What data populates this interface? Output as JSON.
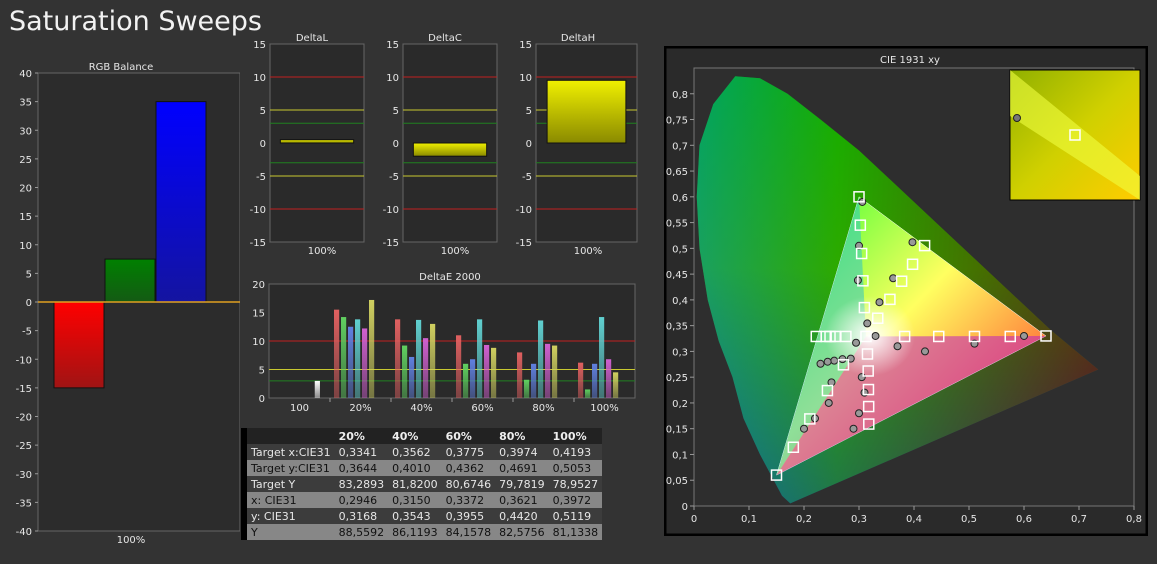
{
  "page": {
    "title": "Saturation Sweeps"
  },
  "rgb_balance": {
    "title": "RGB Balance",
    "xlabel": "100%",
    "ylim": [
      -40,
      40
    ],
    "yticks": [
      "40",
      "35",
      "30",
      "25",
      "20",
      "15",
      "10",
      "5",
      "0",
      "-5",
      "-10",
      "-15",
      "-20",
      "-25",
      "-30",
      "-35",
      "-40"
    ]
  },
  "delta_panels": {
    "yticks": [
      "15",
      "10",
      "5",
      "0",
      "-5",
      "-10",
      "-15"
    ],
    "xlabel": "100%"
  },
  "deltae": {
    "title": "DeltaE 2000",
    "yticks": [
      "20",
      "15",
      "10",
      "5",
      "0"
    ],
    "xticks": [
      "100",
      "20%",
      "40%",
      "60%",
      "80%",
      "100%"
    ]
  },
  "cie": {
    "title": "CIE 1931 xy",
    "xticks": [
      "0",
      "0,1",
      "0,2",
      "0,3",
      "0,4",
      "0,5",
      "0,6",
      "0,7",
      "0,8"
    ],
    "yticks": [
      "0,8",
      "0,75",
      "0,7",
      "0,65",
      "0,6",
      "0,55",
      "0,5",
      "0,45",
      "0,4",
      "0,35",
      "0,3",
      "0,25",
      "0,2",
      "0,15",
      "0,1",
      "0,05",
      "0"
    ]
  },
  "table": {
    "header": [
      "",
      "20%",
      "40%",
      "60%",
      "80%",
      "100%"
    ],
    "rows": [
      {
        "label": "Target x:CIE31",
        "values": [
          "0,3341",
          "0,3562",
          "0,3775",
          "0,3974",
          "0,4193"
        ]
      },
      {
        "label": "Target y:CIE31",
        "values": [
          "0,3644",
          "0,4010",
          "0,4362",
          "0,4691",
          "0,5053"
        ]
      },
      {
        "label": "Target Y",
        "values": [
          "83,2893",
          "81,8200",
          "80,6746",
          "79,7819",
          "78,9527"
        ]
      },
      {
        "label": "x: CIE31",
        "values": [
          "0,2946",
          "0,3150",
          "0,3372",
          "0,3621",
          "0,3972"
        ]
      },
      {
        "label": "y: CIE31",
        "values": [
          "0,3168",
          "0,3543",
          "0,3955",
          "0,4420",
          "0,5119"
        ]
      },
      {
        "label": "Y",
        "values": [
          "88,5592",
          "86,1193",
          "84,1578",
          "82,5756",
          "81,1338"
        ]
      }
    ]
  },
  "chart_data": [
    {
      "type": "bar",
      "title": "RGB Balance",
      "categories": [
        "100%"
      ],
      "series": [
        {
          "color": "#ff0000",
          "values": [
            -15
          ]
        },
        {
          "color": "#008000",
          "values": [
            7.5
          ]
        },
        {
          "color": "#0000ff",
          "values": [
            35
          ]
        }
      ],
      "ylim": [
        -40,
        40
      ]
    },
    {
      "type": "bar",
      "title": "DeltaL",
      "categories": [
        "100%"
      ],
      "values": [
        0.5
      ],
      "ylim": [
        -15,
        15
      ],
      "reference_lines": [
        10,
        5,
        3,
        -3,
        -5,
        -10
      ]
    },
    {
      "type": "bar",
      "title": "DeltaC",
      "categories": [
        "100%"
      ],
      "values": [
        -2
      ],
      "ylim": [
        -15,
        15
      ],
      "reference_lines": [
        10,
        5,
        3,
        -3,
        -5,
        -10
      ]
    },
    {
      "type": "bar",
      "title": "DeltaH",
      "categories": [
        "100%"
      ],
      "values": [
        9.5
      ],
      "ylim": [
        -15,
        15
      ],
      "reference_lines": [
        10,
        5,
        3,
        -3,
        -5,
        -10
      ]
    },
    {
      "type": "bar",
      "title": "DeltaE 2000",
      "categories": [
        "100",
        "20%",
        "40%",
        "60%",
        "80%",
        "100%"
      ],
      "series": [
        {
          "color": "#e06060",
          "values": [
            null,
            15.5,
            13.8,
            11,
            8,
            6.2
          ]
        },
        {
          "color": "#60d060",
          "values": [
            null,
            14.2,
            9.2,
            6,
            3.2,
            1.5
          ]
        },
        {
          "color": "#6080e0",
          "values": [
            null,
            12.5,
            7.2,
            6.8,
            6,
            6
          ]
        },
        {
          "color": "#60d0d0",
          "values": [
            null,
            13.8,
            13.7,
            13.8,
            13.6,
            14.2
          ]
        },
        {
          "color": "#d060d0",
          "values": [
            null,
            12.2,
            10.5,
            9.3,
            9.5,
            6.8
          ]
        },
        {
          "color": "#d0d060",
          "values": [
            null,
            17.2,
            13,
            8.8,
            9.2,
            4.5
          ]
        },
        {
          "color": "#ffffff",
          "values": [
            3,
            null,
            null,
            null,
            null,
            null
          ]
        }
      ],
      "ylim": [
        0,
        20
      ],
      "reference_lines": [
        10,
        5,
        3
      ]
    },
    {
      "type": "scatter",
      "title": "CIE 1931 xy",
      "xlim": [
        0,
        0.8
      ],
      "ylim": [
        0,
        0.85
      ],
      "gamut_triangle": [
        [
          0.64,
          0.33
        ],
        [
          0.3,
          0.6
        ],
        [
          0.15,
          0.06
        ]
      ],
      "targets": [
        [
          0.3127,
          0.329
        ],
        [
          0.383,
          0.329
        ],
        [
          0.445,
          0.329
        ],
        [
          0.51,
          0.329
        ],
        [
          0.575,
          0.329
        ],
        [
          0.64,
          0.33
        ],
        [
          0.3098,
          0.385
        ],
        [
          0.3071,
          0.437
        ],
        [
          0.3048,
          0.49
        ],
        [
          0.3024,
          0.545
        ],
        [
          0.3,
          0.6
        ],
        [
          0.2762,
          0.329
        ],
        [
          0.2473,
          0.329
        ],
        [
          0.2223,
          0.329
        ],
        [
          0.2403,
          0.329
        ],
        [
          0.2568,
          0.329
        ],
        [
          0.2717,
          0.274
        ],
        [
          0.2426,
          0.224
        ],
        [
          0.2106,
          0.169
        ],
        [
          0.1806,
          0.114
        ],
        [
          0.15,
          0.06
        ],
        [
          0.3154,
          0.295
        ],
        [
          0.3167,
          0.262
        ],
        [
          0.3172,
          0.226
        ],
        [
          0.3176,
          0.193
        ],
        [
          0.3178,
          0.159
        ],
        [
          0.3341,
          0.3644
        ],
        [
          0.3562,
          0.401
        ],
        [
          0.3775,
          0.4362
        ],
        [
          0.3974,
          0.4691
        ],
        [
          0.4193,
          0.5053
        ]
      ],
      "measured": [
        [
          0.2946,
          0.3168
        ],
        [
          0.315,
          0.3543
        ],
        [
          0.3372,
          0.3955
        ],
        [
          0.3621,
          0.442
        ],
        [
          0.3972,
          0.5119
        ],
        [
          0.298,
          0.438
        ],
        [
          0.3,
          0.505
        ],
        [
          0.306,
          0.59
        ],
        [
          0.33,
          0.33
        ],
        [
          0.37,
          0.31
        ],
        [
          0.42,
          0.3
        ],
        [
          0.51,
          0.315
        ],
        [
          0.6,
          0.33
        ],
        [
          0.285,
          0.286
        ],
        [
          0.27,
          0.285
        ],
        [
          0.255,
          0.282
        ],
        [
          0.243,
          0.28
        ],
        [
          0.23,
          0.276
        ],
        [
          0.25,
          0.24
        ],
        [
          0.245,
          0.2
        ],
        [
          0.22,
          0.17
        ],
        [
          0.2,
          0.15
        ],
        [
          0.305,
          0.25
        ],
        [
          0.31,
          0.22
        ],
        [
          0.3,
          0.18
        ],
        [
          0.29,
          0.15
        ],
        [
          0.61,
          0.72
        ]
      ]
    }
  ]
}
